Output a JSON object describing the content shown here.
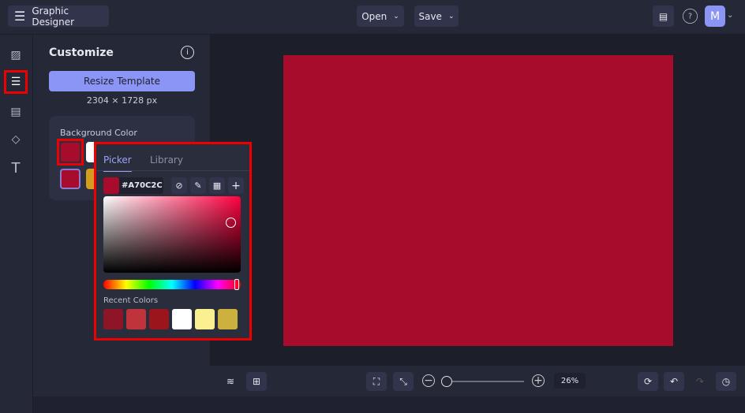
{
  "header": {
    "app_title": "Graphic Designer",
    "open_label": "Open",
    "save_label": "Save",
    "avatar_initial": "M"
  },
  "panel": {
    "title": "Customize",
    "resize_label": "Resize Template",
    "dimensions": "2304 × 1728 px",
    "bg_color_label": "Background Color"
  },
  "picker": {
    "tabs": [
      "Picker",
      "Library"
    ],
    "hex": "#A70C2C",
    "recent_label": "Recent Colors",
    "recent_colors": [
      "#8e1427",
      "#c0333a",
      "#9a151c",
      "#ffffff",
      "#fbf08f",
      "#cdb13e"
    ]
  },
  "canvas": {
    "color": "#A70C2C"
  },
  "zoom": {
    "level": "26%",
    "fraction": 0.02
  }
}
